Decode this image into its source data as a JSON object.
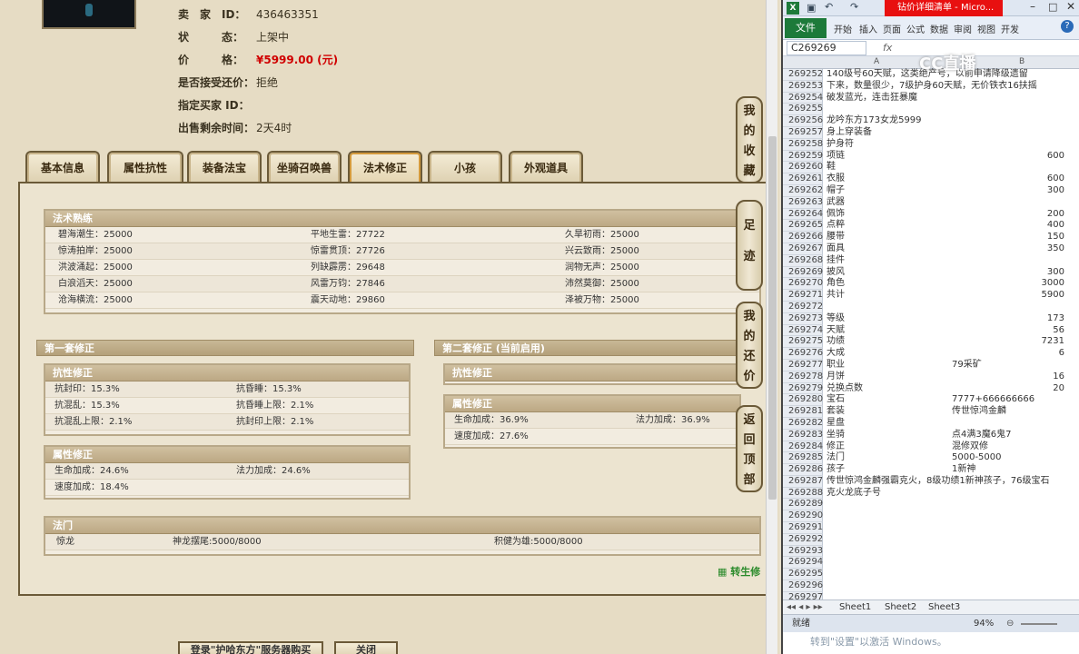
{
  "item": {
    "seller_label": "卖　家　ID：",
    "seller_value": "436463351",
    "status_label": "状　　　态：",
    "status_value": "上架中",
    "price_label": "价　　　格：",
    "price_value": "¥5999.00 (元)",
    "counteroffer_label": "是否接受还价：",
    "counteroffer_value": "拒绝",
    "buyer_label": "指定买家 ID：",
    "buyer_value": "",
    "time_label": "出售剩余时间：",
    "time_value": "2天4时"
  },
  "tabs": [
    "基本信息",
    "属性抗性",
    "装备法宝",
    "坐骑召唤兽",
    "法术修正",
    "小孩",
    "外观道具"
  ],
  "mastery": {
    "title": "法术熟练",
    "rows": [
      [
        "碧海潮生：25000",
        "平地生雷：27722",
        "久旱初雨：25000"
      ],
      [
        "惊涛拍岸：25000",
        "惊雷贯顶：27726",
        "兴云致雨：25000"
      ],
      [
        "洪波涌起：25000",
        "列缺霹雳：29648",
        "润物无声：25000"
      ],
      [
        "白浪滔天：25000",
        "风雷万钧：27846",
        "沛然莫御：25000"
      ],
      [
        "沧海横流：25000",
        "震天动地：29860",
        "泽被万物：25000"
      ]
    ]
  },
  "set1": {
    "title": "第一套修正",
    "resist_title": "抗性修正",
    "resist_rows": [
      [
        "抗封印：15.3%",
        "抗昏睡：15.3%"
      ],
      [
        "抗混乱：15.3%",
        "抗昏睡上限：2.1%"
      ],
      [
        "抗混乱上限：2.1%",
        "抗封印上限：2.1%"
      ]
    ],
    "attr_title": "属性修正",
    "attr_rows": [
      [
        "生命加成：24.6%",
        "法力加成：24.6%"
      ],
      [
        "速度加成：18.4%",
        ""
      ]
    ]
  },
  "set2": {
    "title": "第二套修正 (当前启用)",
    "resist_title": "抗性修正",
    "attr_title": "属性修正",
    "attr_rows": [
      [
        "生命加成：36.9%",
        "法力加成：36.9%"
      ],
      [
        "速度加成：27.6%",
        ""
      ]
    ]
  },
  "fmen": {
    "title": "法门",
    "row": [
      "惊龙",
      "神龙摆尾:5000/8000",
      "积健为雄:5000/8000"
    ]
  },
  "side_buttons": [
    "我的收藏",
    "足迹",
    "我的还价",
    "返回顶部"
  ],
  "footer_link": "转生修",
  "bottom_buttons": [
    "登录\"护哈东方\"服务器购买",
    "关闭"
  ],
  "excel": {
    "title": "钻价详细清单 - Micro...",
    "ribbon_tabs": [
      "开始",
      "插入",
      "页面",
      "公式",
      "数据",
      "审阅",
      "视图",
      "开发"
    ],
    "file_tab": "文件",
    "name_box": "C269269",
    "fx": "fx",
    "rows": [
      {
        "n": "269252",
        "a": "140级号60天赋，这类绝产号，以前申请降级遗留",
        "b": "",
        "c": ""
      },
      {
        "n": "269253",
        "a": "下来，数量很少，7级护身60天赋，无价铁衣16扶摇",
        "b": "",
        "c": ""
      },
      {
        "n": "269254",
        "a": "破发蓝光，连击狂暴魔",
        "b": "",
        "c": ""
      },
      {
        "n": "269255",
        "a": "",
        "b": "",
        "c": ""
      },
      {
        "n": "269256",
        "a": "龙吟东方173女龙5999",
        "b": "",
        "c": ""
      },
      {
        "n": "269257",
        "a": "身上穿装备",
        "b": "",
        "c": ""
      },
      {
        "n": "269258",
        "a": "护身符",
        "b": "",
        "c": ""
      },
      {
        "n": "269259",
        "a": "项链",
        "b": "",
        "c": "600"
      },
      {
        "n": "269260",
        "a": "鞋",
        "b": "",
        "c": ""
      },
      {
        "n": "269261",
        "a": "衣服",
        "b": "",
        "c": "600"
      },
      {
        "n": "269262",
        "a": "帽子",
        "b": "",
        "c": "300"
      },
      {
        "n": "269263",
        "a": "武器",
        "b": "",
        "c": ""
      },
      {
        "n": "269264",
        "a": "佩饰",
        "b": "",
        "c": "200"
      },
      {
        "n": "269265",
        "a": "点粹",
        "b": "",
        "c": "400"
      },
      {
        "n": "269266",
        "a": "腰带",
        "b": "",
        "c": "150"
      },
      {
        "n": "269267",
        "a": "面具",
        "b": "",
        "c": "350"
      },
      {
        "n": "269268",
        "a": "挂件",
        "b": "",
        "c": ""
      },
      {
        "n": "269269",
        "a": "披风",
        "b": "",
        "c": "300"
      },
      {
        "n": "269270",
        "a": "角色",
        "b": "",
        "c": "3000"
      },
      {
        "n": "269271",
        "a": "共计",
        "b": "",
        "c": "5900"
      },
      {
        "n": "269272",
        "a": "",
        "b": "",
        "c": ""
      },
      {
        "n": "269273",
        "a": "等级",
        "b": "",
        "c": "173"
      },
      {
        "n": "269274",
        "a": "天赋",
        "b": "",
        "c": "56"
      },
      {
        "n": "269275",
        "a": "功绩",
        "b": "",
        "c": "7231"
      },
      {
        "n": "269276",
        "a": "大成",
        "b": "",
        "c": "6"
      },
      {
        "n": "269277",
        "a": "职业",
        "b": "79采矿",
        "c": ""
      },
      {
        "n": "269278",
        "a": "月饼",
        "b": "",
        "c": "16"
      },
      {
        "n": "269279",
        "a": "兑换点数",
        "b": "",
        "c": "20"
      },
      {
        "n": "269280",
        "a": "宝石",
        "b": "7777+666666666",
        "c": ""
      },
      {
        "n": "269281",
        "a": "套装",
        "b": "传世惊鸿金麟",
        "c": ""
      },
      {
        "n": "269282",
        "a": "星盘",
        "b": "",
        "c": ""
      },
      {
        "n": "269283",
        "a": "坐骑",
        "b": "点4满3魔6鬼7",
        "c": ""
      },
      {
        "n": "269284",
        "a": "修正",
        "b": "混修双修",
        "c": ""
      },
      {
        "n": "269285",
        "a": "法门",
        "b": "5000-5000",
        "c": ""
      },
      {
        "n": "269286",
        "a": "孩子",
        "b": "1新神",
        "c": ""
      },
      {
        "n": "269287",
        "a": "传世惊鸿金麟强霸克火，8级功绩1新神孩子，76级宝石",
        "b": "",
        "c": ""
      },
      {
        "n": "269288",
        "a": "克火龙底子号",
        "b": "",
        "c": ""
      },
      {
        "n": "269289",
        "a": "",
        "b": "",
        "c": ""
      },
      {
        "n": "269290",
        "a": "",
        "b": "",
        "c": ""
      },
      {
        "n": "269291",
        "a": "",
        "b": "",
        "c": ""
      },
      {
        "n": "269292",
        "a": "",
        "b": "",
        "c": ""
      },
      {
        "n": "269293",
        "a": "",
        "b": "",
        "c": ""
      },
      {
        "n": "269294",
        "a": "",
        "b": "",
        "c": ""
      },
      {
        "n": "269295",
        "a": "",
        "b": "",
        "c": ""
      },
      {
        "n": "269296",
        "a": "",
        "b": "",
        "c": ""
      },
      {
        "n": "269297",
        "a": "",
        "b": "",
        "c": ""
      }
    ],
    "sheets": [
      "Sheet1",
      "Sheet2",
      "Sheet3"
    ],
    "status": "就绪",
    "zoom": "94%",
    "watermark": "转到\"设置\"以激活 Windows。",
    "logo_text": "CC直播"
  }
}
